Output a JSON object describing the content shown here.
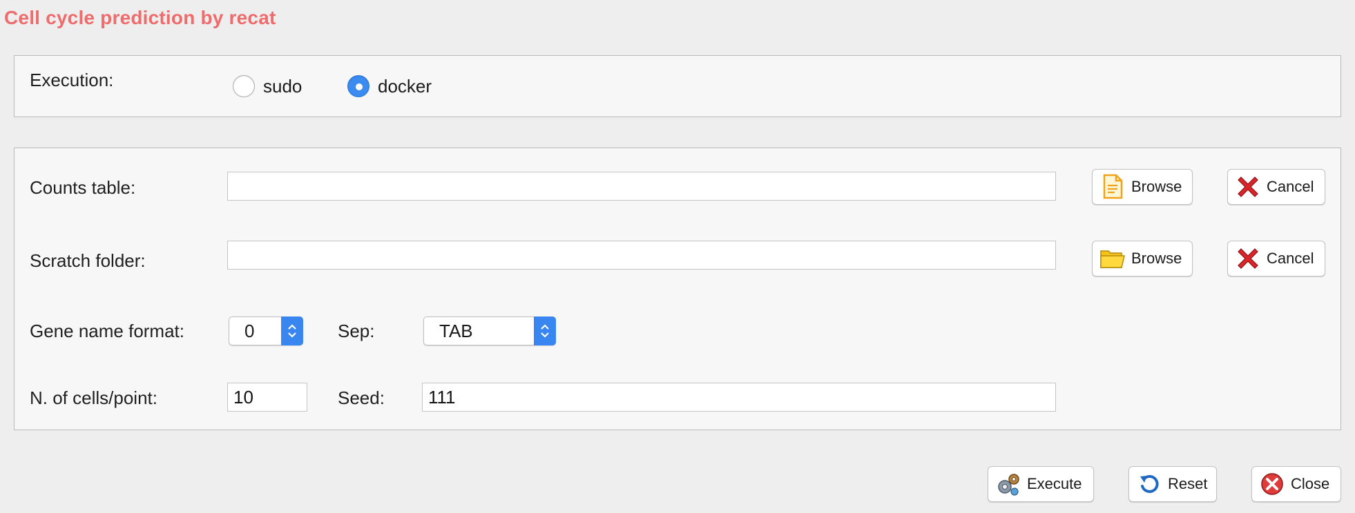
{
  "window": {
    "title": "Cell cycle prediction by recat"
  },
  "execution": {
    "label": "Execution:",
    "options": [
      {
        "label": "sudo",
        "selected": false
      },
      {
        "label": "docker",
        "selected": true
      }
    ]
  },
  "counts_table": {
    "label": "Counts table:",
    "value": "",
    "browse_label": "Browse",
    "cancel_label": "Cancel",
    "browse_icon": "document-icon",
    "cancel_icon": "red-x-icon"
  },
  "scratch_folder": {
    "label": "Scratch folder:",
    "value": "",
    "browse_label": "Browse",
    "cancel_label": "Cancel",
    "browse_icon": "folder-icon",
    "cancel_icon": "red-x-icon"
  },
  "gene_name_format": {
    "label": "Gene name format:",
    "value": "0"
  },
  "sep": {
    "label": "Sep:",
    "value": "TAB"
  },
  "cells_per_point": {
    "label": "N. of cells/point:",
    "value": "10"
  },
  "seed": {
    "label": "Seed:",
    "value": "111"
  },
  "footer": {
    "execute_label": "Execute",
    "reset_label": "Reset",
    "close_label": "Close",
    "execute_icon": "gears-icon",
    "reset_icon": "refresh-icon",
    "close_icon": "close-circle-icon"
  },
  "colors": {
    "title": "#f06b6b",
    "accent": "#3b8bf0",
    "panel_bg": "#f7f7f7",
    "window_bg": "#eeeeee"
  }
}
